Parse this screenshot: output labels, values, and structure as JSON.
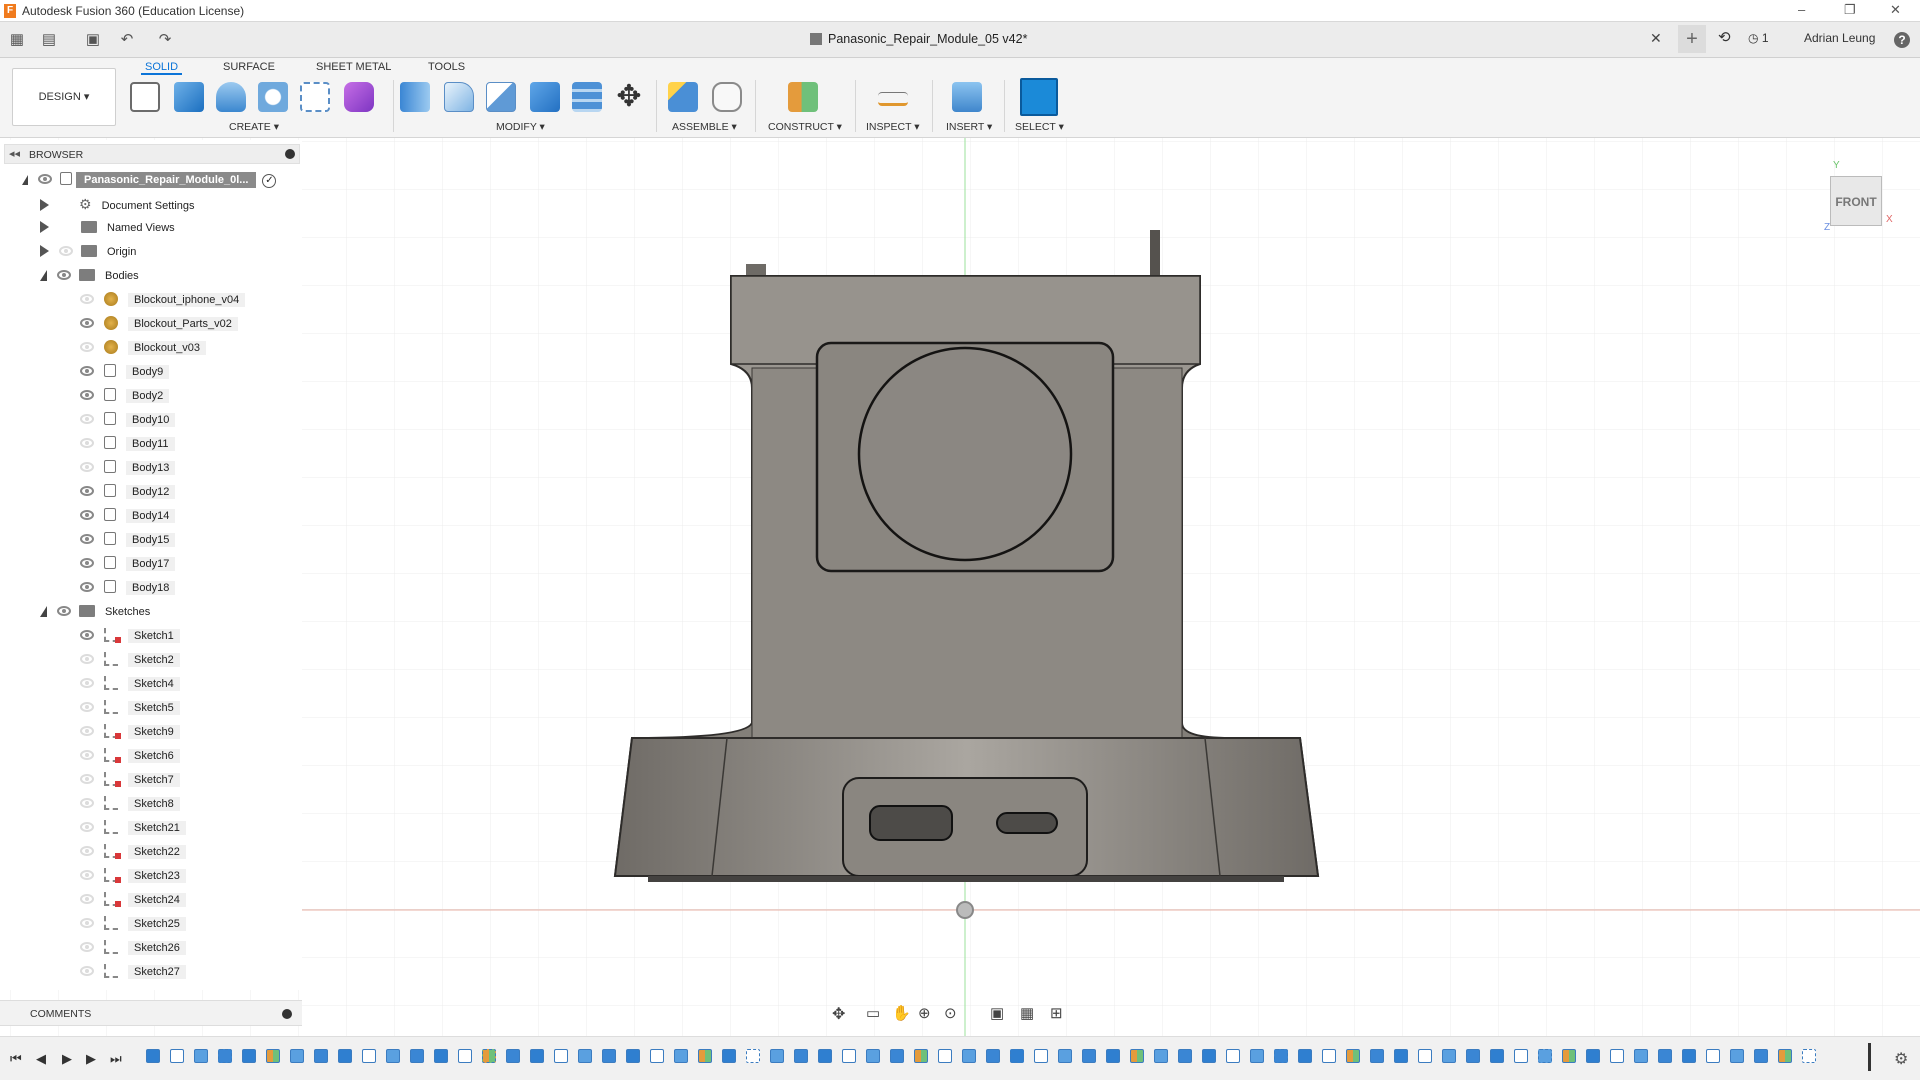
{
  "app": {
    "title": "Autodesk Fusion 360 (Education License)"
  },
  "window_controls": {
    "minimize": "–",
    "restore": "❐",
    "close": "✕"
  },
  "document_tab": {
    "name": "Panasonic_Repair_Module_05 v42*",
    "close": "✕",
    "new_tab": "+"
  },
  "header_right": {
    "jobs": "1",
    "user": "Adrian Leung",
    "help": "?"
  },
  "workspace_tabs": [
    "SOLID",
    "SURFACE",
    "SHEET METAL",
    "TOOLS"
  ],
  "active_tab": "SOLID",
  "workspace_button": "DESIGN ▾",
  "toolbar_groups": {
    "create": "CREATE ▾",
    "modify": "MODIFY ▾",
    "assemble": "ASSEMBLE ▾",
    "construct": "CONSTRUCT ▾",
    "inspect": "INSPECT ▾",
    "insert": "INSERT ▾",
    "select": "SELECT ▾"
  },
  "browser": {
    "title": "BROWSER",
    "root": "Panasonic_Repair_Module_0l...",
    "items": [
      {
        "label": "Document Settings",
        "type": "settings",
        "level": 1,
        "expand": "closed"
      },
      {
        "label": "Named Views",
        "type": "folder",
        "level": 1,
        "expand": "closed"
      },
      {
        "label": "Origin",
        "type": "folder",
        "level": 1,
        "expand": "closed",
        "eye": "dim"
      },
      {
        "label": "Bodies",
        "type": "folder",
        "level": 1,
        "expand": "open",
        "eye": "on"
      },
      {
        "label": "Blockout_iphone_v04",
        "type": "component",
        "level": 2,
        "eye": "dim"
      },
      {
        "label": "Blockout_Parts_v02",
        "type": "component",
        "level": 2,
        "eye": "on"
      },
      {
        "label": "Blockout_v03",
        "type": "component",
        "level": 2,
        "eye": "dim"
      },
      {
        "label": "Body9",
        "type": "body",
        "level": 2,
        "eye": "on"
      },
      {
        "label": "Body2",
        "type": "body",
        "level": 2,
        "eye": "on"
      },
      {
        "label": "Body10",
        "type": "body",
        "level": 2,
        "eye": "dim"
      },
      {
        "label": "Body11",
        "type": "body",
        "level": 2,
        "eye": "dim"
      },
      {
        "label": "Body13",
        "type": "body",
        "level": 2,
        "eye": "dim"
      },
      {
        "label": "Body12",
        "type": "body",
        "level": 2,
        "eye": "on"
      },
      {
        "label": "Body14",
        "type": "body",
        "level": 2,
        "eye": "on"
      },
      {
        "label": "Body15",
        "type": "body",
        "level": 2,
        "eye": "on"
      },
      {
        "label": "Body17",
        "type": "body",
        "level": 2,
        "eye": "on"
      },
      {
        "label": "Body18",
        "type": "body",
        "level": 2,
        "eye": "on"
      },
      {
        "label": "Sketches",
        "type": "folder",
        "level": 1,
        "expand": "open",
        "eye": "on"
      },
      {
        "label": "Sketch1",
        "type": "sketch",
        "level": 2,
        "eye": "on",
        "red": true
      },
      {
        "label": "Sketch2",
        "type": "sketch",
        "level": 2,
        "eye": "dim",
        "red": false
      },
      {
        "label": "Sketch4",
        "type": "sketch",
        "level": 2,
        "eye": "dim",
        "red": false
      },
      {
        "label": "Sketch5",
        "type": "sketch",
        "level": 2,
        "eye": "dim",
        "red": false
      },
      {
        "label": "Sketch9",
        "type": "sketch",
        "level": 2,
        "eye": "dim",
        "red": true
      },
      {
        "label": "Sketch6",
        "type": "sketch",
        "level": 2,
        "eye": "dim",
        "red": true
      },
      {
        "label": "Sketch7",
        "type": "sketch",
        "level": 2,
        "eye": "dim",
        "red": true
      },
      {
        "label": "Sketch8",
        "type": "sketch",
        "level": 2,
        "eye": "dim",
        "red": false
      },
      {
        "label": "Sketch21",
        "type": "sketch",
        "level": 2,
        "eye": "dim",
        "red": false
      },
      {
        "label": "Sketch22",
        "type": "sketch",
        "level": 2,
        "eye": "dim",
        "red": true
      },
      {
        "label": "Sketch23",
        "type": "sketch",
        "level": 2,
        "eye": "dim",
        "red": true
      },
      {
        "label": "Sketch24",
        "type": "sketch",
        "level": 2,
        "eye": "dim",
        "red": true
      },
      {
        "label": "Sketch25",
        "type": "sketch",
        "level": 2,
        "eye": "dim",
        "red": false
      },
      {
        "label": "Sketch26",
        "type": "sketch",
        "level": 2,
        "eye": "dim",
        "red": false
      },
      {
        "label": "Sketch27",
        "type": "sketch",
        "level": 2,
        "eye": "dim",
        "red": false
      }
    ]
  },
  "comments": {
    "title": "COMMENTS"
  },
  "viewcube": {
    "face": "FRONT",
    "axis_y": "Y",
    "axis_x": "X",
    "axis_z": "Z"
  },
  "colors": {
    "accent": "#0b74d8",
    "body_metal": "#8e8a84",
    "grid": "#e6e6e6",
    "select_icon": "#1b8ad8"
  },
  "timeline": {
    "controls": [
      "⏮",
      "◀",
      "▶",
      "▶",
      "⏭"
    ]
  }
}
